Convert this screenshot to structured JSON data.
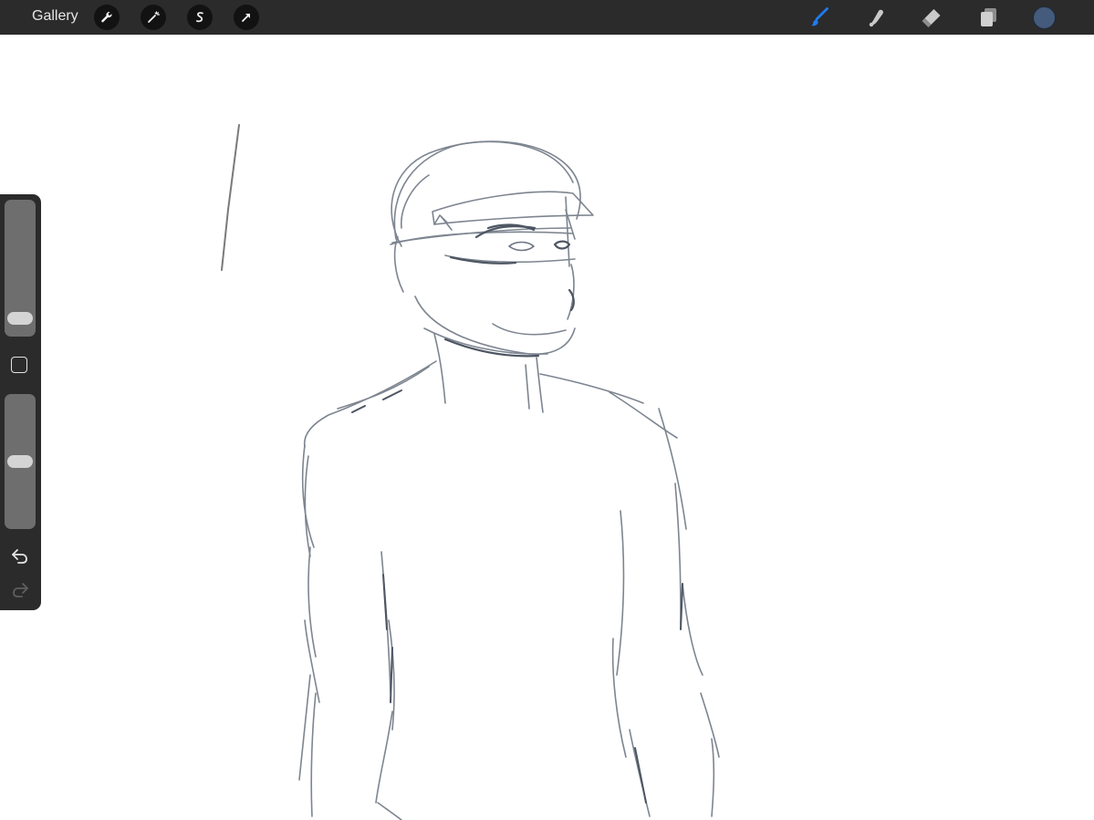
{
  "topbar": {
    "gallery_label": "Gallery",
    "left_tools": [
      {
        "icon": "wrench-icon",
        "name": "actions"
      },
      {
        "icon": "magic-wand-icon",
        "name": "adjustments"
      },
      {
        "icon": "selection-s-icon",
        "name": "selection"
      },
      {
        "icon": "transform-arrow-icon",
        "name": "transform"
      }
    ],
    "right_tools": [
      {
        "icon": "brush-icon",
        "name": "paint",
        "active": true
      },
      {
        "icon": "smudge-icon",
        "name": "smudge"
      },
      {
        "icon": "eraser-icon",
        "name": "eraser"
      },
      {
        "icon": "layers-icon",
        "name": "layers"
      }
    ],
    "current_color": "#445b7c",
    "active_accent": "#1f7bf0"
  },
  "sidebar": {
    "brush_size_level": 0.08,
    "opacity_level": 0.5,
    "modify_button": "square-icon",
    "undo": "undo-arrow-icon",
    "redo": "redo-arrow-icon"
  },
  "canvas": {
    "background": "#ffffff",
    "stroke_color": "#6b7480",
    "subject": "sketch-figure"
  }
}
